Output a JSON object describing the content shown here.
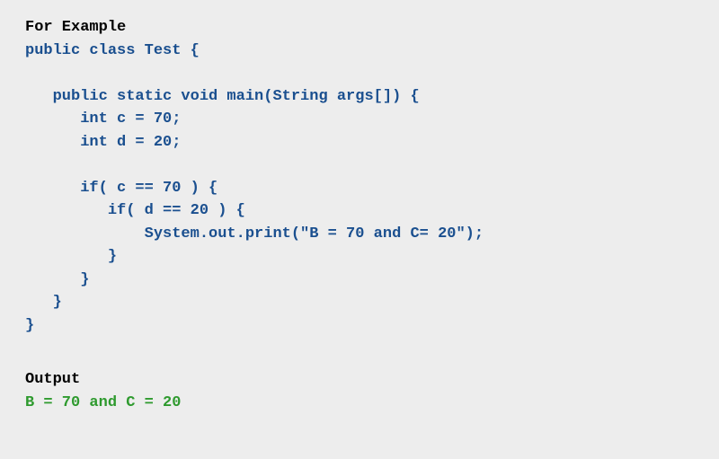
{
  "example_heading": "For Example",
  "code": {
    "line1": "public class Test {",
    "line2": "",
    "line3": "   public static void main(String args[]) {",
    "line4": "      int c = 70;",
    "line5": "      int d = 20;",
    "line6": "",
    "line7": "      if( c == 70 ) {",
    "line8": "         if( d == 20 ) {",
    "line9": "             System.out.print(\"B = 70 and C= 20\");",
    "line10": "         }",
    "line11": "      }",
    "line12": "   }",
    "line13": "}"
  },
  "output_heading": "Output",
  "output_line": "B = 70 and C = 20"
}
